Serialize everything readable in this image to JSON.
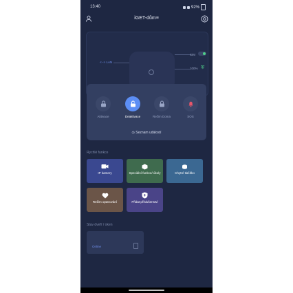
{
  "status_bar": {
    "time": "13:40",
    "battery": "92%"
  },
  "header": {
    "title": "iGET-dům≡"
  },
  "device": {
    "lan_label": "<--> LAN",
    "sim_label": "SIM",
    "battery_label": "100%"
  },
  "modes": [
    {
      "label": "Aktivace",
      "icon": "lock-icon",
      "active": false
    },
    {
      "label": "Deaktivace",
      "icon": "unlock-icon",
      "active": true
    },
    {
      "label": "Režim Doma",
      "icon": "lock-home-icon",
      "active": false
    },
    {
      "label": "SOS",
      "icon": "bell-icon",
      "active": false
    }
  ],
  "events_label": "Seznam událostí",
  "quick_section": {
    "title": "Rychlé funkce"
  },
  "tiles": [
    {
      "label": "IP kamery",
      "icon": "camera-icon",
      "color": "#3a4890"
    },
    {
      "label": "Speciální funkce/ úkoly",
      "icon": "cube-icon",
      "color": "#3f6b4e"
    },
    {
      "label": "Chytré tlačítko",
      "icon": "smart-button-icon",
      "color": "#3b6892"
    },
    {
      "label": "Režim opatrování",
      "icon": "heart-icon",
      "color": "#6b5548"
    },
    {
      "label": "Přidat příslušenství",
      "icon": "shield-plus-icon",
      "color": "#4a4488"
    }
  ],
  "status_section": {
    "title": "Stav dveří / oken"
  },
  "status_card": {
    "state": "Online"
  },
  "colors": {
    "background": "#1e2742",
    "accent": "#5c8ef5",
    "sos": "#e8566a"
  }
}
